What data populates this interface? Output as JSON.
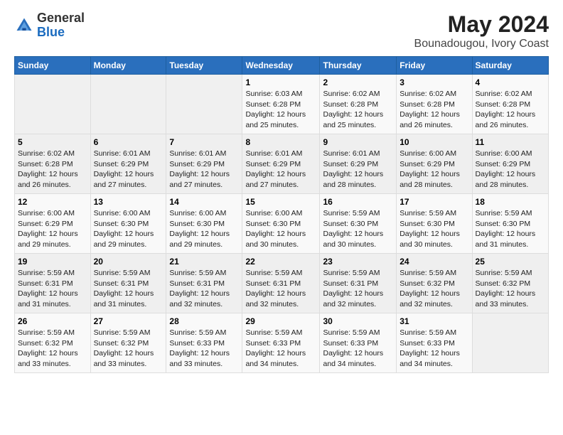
{
  "logo": {
    "general": "General",
    "blue": "Blue"
  },
  "header": {
    "month_year": "May 2024",
    "location": "Bounadougou, Ivory Coast"
  },
  "weekdays": [
    "Sunday",
    "Monday",
    "Tuesday",
    "Wednesday",
    "Thursday",
    "Friday",
    "Saturday"
  ],
  "weeks": [
    [
      {
        "day": "",
        "sunrise": "",
        "sunset": "",
        "daylight": ""
      },
      {
        "day": "",
        "sunrise": "",
        "sunset": "",
        "daylight": ""
      },
      {
        "day": "",
        "sunrise": "",
        "sunset": "",
        "daylight": ""
      },
      {
        "day": "1",
        "sunrise": "Sunrise: 6:03 AM",
        "sunset": "Sunset: 6:28 PM",
        "daylight": "Daylight: 12 hours and 25 minutes."
      },
      {
        "day": "2",
        "sunrise": "Sunrise: 6:02 AM",
        "sunset": "Sunset: 6:28 PM",
        "daylight": "Daylight: 12 hours and 25 minutes."
      },
      {
        "day": "3",
        "sunrise": "Sunrise: 6:02 AM",
        "sunset": "Sunset: 6:28 PM",
        "daylight": "Daylight: 12 hours and 26 minutes."
      },
      {
        "day": "4",
        "sunrise": "Sunrise: 6:02 AM",
        "sunset": "Sunset: 6:28 PM",
        "daylight": "Daylight: 12 hours and 26 minutes."
      }
    ],
    [
      {
        "day": "5",
        "sunrise": "Sunrise: 6:02 AM",
        "sunset": "Sunset: 6:28 PM",
        "daylight": "Daylight: 12 hours and 26 minutes."
      },
      {
        "day": "6",
        "sunrise": "Sunrise: 6:01 AM",
        "sunset": "Sunset: 6:29 PM",
        "daylight": "Daylight: 12 hours and 27 minutes."
      },
      {
        "day": "7",
        "sunrise": "Sunrise: 6:01 AM",
        "sunset": "Sunset: 6:29 PM",
        "daylight": "Daylight: 12 hours and 27 minutes."
      },
      {
        "day": "8",
        "sunrise": "Sunrise: 6:01 AM",
        "sunset": "Sunset: 6:29 PM",
        "daylight": "Daylight: 12 hours and 27 minutes."
      },
      {
        "day": "9",
        "sunrise": "Sunrise: 6:01 AM",
        "sunset": "Sunset: 6:29 PM",
        "daylight": "Daylight: 12 hours and 28 minutes."
      },
      {
        "day": "10",
        "sunrise": "Sunrise: 6:00 AM",
        "sunset": "Sunset: 6:29 PM",
        "daylight": "Daylight: 12 hours and 28 minutes."
      },
      {
        "day": "11",
        "sunrise": "Sunrise: 6:00 AM",
        "sunset": "Sunset: 6:29 PM",
        "daylight": "Daylight: 12 hours and 28 minutes."
      }
    ],
    [
      {
        "day": "12",
        "sunrise": "Sunrise: 6:00 AM",
        "sunset": "Sunset: 6:29 PM",
        "daylight": "Daylight: 12 hours and 29 minutes."
      },
      {
        "day": "13",
        "sunrise": "Sunrise: 6:00 AM",
        "sunset": "Sunset: 6:30 PM",
        "daylight": "Daylight: 12 hours and 29 minutes."
      },
      {
        "day": "14",
        "sunrise": "Sunrise: 6:00 AM",
        "sunset": "Sunset: 6:30 PM",
        "daylight": "Daylight: 12 hours and 29 minutes."
      },
      {
        "day": "15",
        "sunrise": "Sunrise: 6:00 AM",
        "sunset": "Sunset: 6:30 PM",
        "daylight": "Daylight: 12 hours and 30 minutes."
      },
      {
        "day": "16",
        "sunrise": "Sunrise: 5:59 AM",
        "sunset": "Sunset: 6:30 PM",
        "daylight": "Daylight: 12 hours and 30 minutes."
      },
      {
        "day": "17",
        "sunrise": "Sunrise: 5:59 AM",
        "sunset": "Sunset: 6:30 PM",
        "daylight": "Daylight: 12 hours and 30 minutes."
      },
      {
        "day": "18",
        "sunrise": "Sunrise: 5:59 AM",
        "sunset": "Sunset: 6:30 PM",
        "daylight": "Daylight: 12 hours and 31 minutes."
      }
    ],
    [
      {
        "day": "19",
        "sunrise": "Sunrise: 5:59 AM",
        "sunset": "Sunset: 6:31 PM",
        "daylight": "Daylight: 12 hours and 31 minutes."
      },
      {
        "day": "20",
        "sunrise": "Sunrise: 5:59 AM",
        "sunset": "Sunset: 6:31 PM",
        "daylight": "Daylight: 12 hours and 31 minutes."
      },
      {
        "day": "21",
        "sunrise": "Sunrise: 5:59 AM",
        "sunset": "Sunset: 6:31 PM",
        "daylight": "Daylight: 12 hours and 32 minutes."
      },
      {
        "day": "22",
        "sunrise": "Sunrise: 5:59 AM",
        "sunset": "Sunset: 6:31 PM",
        "daylight": "Daylight: 12 hours and 32 minutes."
      },
      {
        "day": "23",
        "sunrise": "Sunrise: 5:59 AM",
        "sunset": "Sunset: 6:31 PM",
        "daylight": "Daylight: 12 hours and 32 minutes."
      },
      {
        "day": "24",
        "sunrise": "Sunrise: 5:59 AM",
        "sunset": "Sunset: 6:32 PM",
        "daylight": "Daylight: 12 hours and 32 minutes."
      },
      {
        "day": "25",
        "sunrise": "Sunrise: 5:59 AM",
        "sunset": "Sunset: 6:32 PM",
        "daylight": "Daylight: 12 hours and 33 minutes."
      }
    ],
    [
      {
        "day": "26",
        "sunrise": "Sunrise: 5:59 AM",
        "sunset": "Sunset: 6:32 PM",
        "daylight": "Daylight: 12 hours and 33 minutes."
      },
      {
        "day": "27",
        "sunrise": "Sunrise: 5:59 AM",
        "sunset": "Sunset: 6:32 PM",
        "daylight": "Daylight: 12 hours and 33 minutes."
      },
      {
        "day": "28",
        "sunrise": "Sunrise: 5:59 AM",
        "sunset": "Sunset: 6:33 PM",
        "daylight": "Daylight: 12 hours and 33 minutes."
      },
      {
        "day": "29",
        "sunrise": "Sunrise: 5:59 AM",
        "sunset": "Sunset: 6:33 PM",
        "daylight": "Daylight: 12 hours and 34 minutes."
      },
      {
        "day": "30",
        "sunrise": "Sunrise: 5:59 AM",
        "sunset": "Sunset: 6:33 PM",
        "daylight": "Daylight: 12 hours and 34 minutes."
      },
      {
        "day": "31",
        "sunrise": "Sunrise: 5:59 AM",
        "sunset": "Sunset: 6:33 PM",
        "daylight": "Daylight: 12 hours and 34 minutes."
      },
      {
        "day": "",
        "sunrise": "",
        "sunset": "",
        "daylight": ""
      }
    ]
  ]
}
